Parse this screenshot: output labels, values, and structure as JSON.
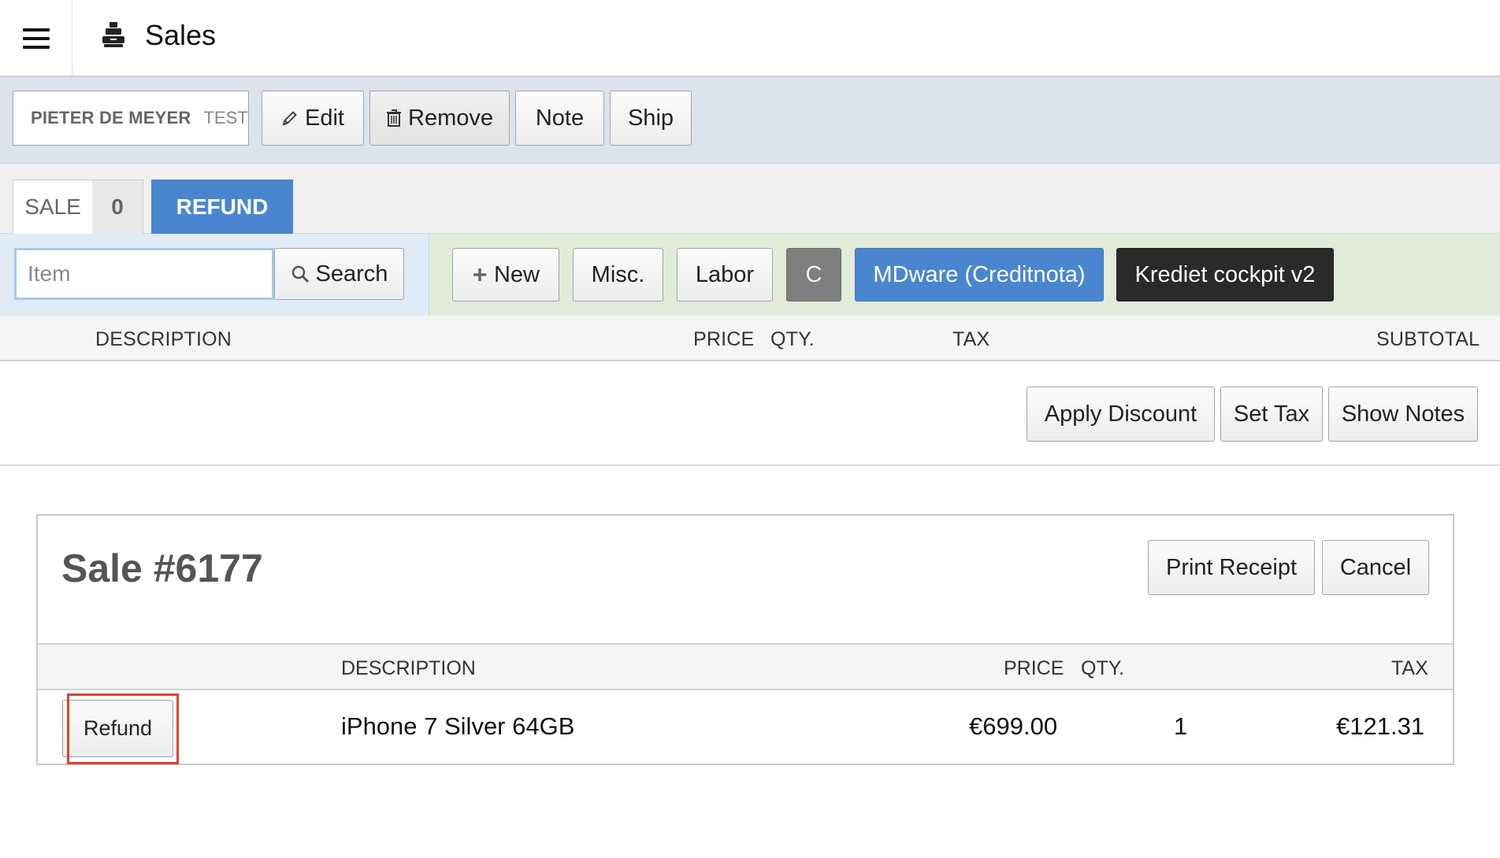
{
  "app": {
    "title": "Sales",
    "menu_icon": "hamburger-icon",
    "app_icon": "register-icon"
  },
  "customer": {
    "name": "PIETER DE MEYER",
    "tag": "TEST"
  },
  "toolbar": {
    "edit": "Edit",
    "remove": "Remove",
    "note": "Note",
    "ship": "Ship"
  },
  "tabs": {
    "sale_label": "SALE",
    "sale_count": "0",
    "refund_label": "REFUND"
  },
  "search": {
    "placeholder": "Item",
    "button": "Search"
  },
  "quick": {
    "new": "New",
    "misc": "Misc.",
    "labor": "Labor",
    "c": "C",
    "mdware": "MDware (Creditnota)",
    "krediet": "Krediet cockpit v2"
  },
  "line_header": {
    "description": "DESCRIPTION",
    "price": "PRICE",
    "qty": "QTY.",
    "tax": "TAX",
    "subtotal": "SUBTOTAL"
  },
  "sale_actions": {
    "apply_discount": "Apply Discount",
    "set_tax": "Set Tax",
    "show_notes": "Show Notes"
  },
  "previous_sale": {
    "title": "Sale #6177",
    "print_receipt": "Print Receipt",
    "cancel": "Cancel",
    "columns": {
      "description": "DESCRIPTION",
      "price": "PRICE",
      "qty": "QTY.",
      "tax": "TAX"
    },
    "items": [
      {
        "refund_label": "Refund",
        "description": "iPhone 7 Silver 64GB",
        "price": "€699.00",
        "qty": "1",
        "tax": "€121.31"
      }
    ]
  },
  "colors": {
    "accent_blue": "#4a86d0",
    "dark_button": "#2a2a2a",
    "highlight": "#e0402e"
  }
}
